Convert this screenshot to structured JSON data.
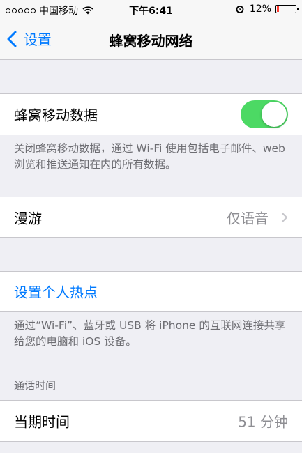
{
  "status": {
    "carrier": "中国移动",
    "time": "下午6:41",
    "battery": "12%",
    "battery_level": 0.12,
    "battery_color": "#ff3b30"
  },
  "nav": {
    "back_label": "设置",
    "title": "蜂窝移动网络"
  },
  "cellular_data": {
    "label": "蜂窝移动数据",
    "enabled": true,
    "footer": "关闭蜂窝移动数据，通过 Wi-Fi 使用包括电子邮件、web 浏览和推送通知在内的所有数据。"
  },
  "roaming": {
    "label": "漫游",
    "value": "仅语音"
  },
  "hotspot": {
    "label": "设置个人热点",
    "footer": "通过“Wi-Fi”、蓝牙或 USB 将 iPhone 的互联网连接共享给您的电脑和 iOS 设备。"
  },
  "call_time": {
    "header": "通话时间",
    "current_label": "当期时间",
    "current_value": "51 分钟"
  },
  "colors": {
    "accent": "#007aff",
    "toggle_on": "#4cd964",
    "background": "#efeff4"
  }
}
